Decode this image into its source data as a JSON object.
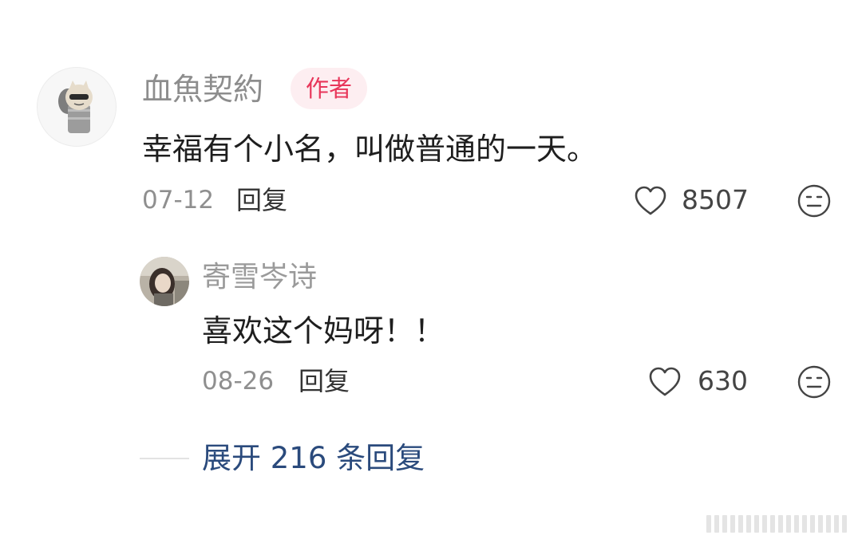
{
  "comment": {
    "author_name": "血魚契約",
    "author_badge": "作者",
    "text": "幸福有个小名，叫做普通的一天。",
    "date": "07-12",
    "reply_label": "回复",
    "like_count": "8507"
  },
  "reply": {
    "author_name": "寄雪岑诗",
    "text": "喜欢这个妈呀！！",
    "date": "08-26",
    "reply_label": "回复",
    "like_count": "630"
  },
  "expand": {
    "label": "展开 216 条回复"
  },
  "colors": {
    "badge_bg": "#fdeef1",
    "badge_text": "#e8365a",
    "expand_text": "#2a4a7c",
    "name_text": "#8d8d8d"
  },
  "icons": {
    "like": "heart-outline-icon",
    "dislike": "neutral-face-icon"
  }
}
